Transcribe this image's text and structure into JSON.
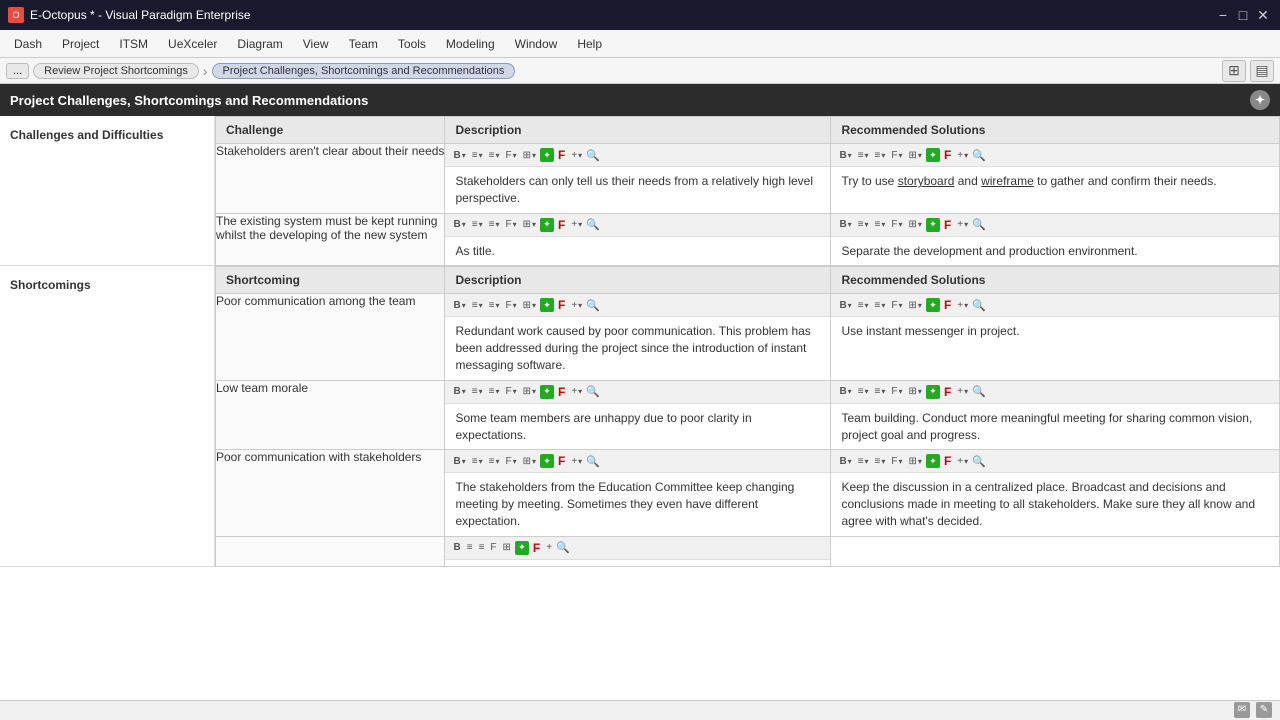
{
  "titlebar": {
    "title": "E-Octopus * - Visual Paradigm Enterprise",
    "icon": "O",
    "min": "−",
    "max": "□",
    "close": "✕"
  },
  "menu": {
    "items": [
      "Dash",
      "Project",
      "ITSM",
      "UeXceler",
      "Diagram",
      "View",
      "Team",
      "Tools",
      "Modeling",
      "Window",
      "Help"
    ]
  },
  "breadcrumb": {
    "more": "...",
    "items": [
      "Review Project Shortcomings",
      "Project Challenges, Shortcomings and Recommendations"
    ]
  },
  "pageHeader": {
    "title": "Project Challenges, Shortcomings and Recommendations"
  },
  "sections": [
    {
      "label": "Challenges and Difficulties",
      "columns": [
        "Challenge",
        "Description",
        "Recommended Solutions"
      ],
      "rows": [
        {
          "challenge": "Stakeholders aren't clear about their needs",
          "description": "Stakeholders can only tell us their needs from a relatively high level perspective.",
          "recommended": "Try to use storyboard and wireframe to gather and confirm their needs."
        },
        {
          "challenge": "The existing system must be kept running whilst the developing of the new system",
          "description": "As title.",
          "recommended": "Separate the development and production environment."
        }
      ]
    },
    {
      "label": "Shortcomings",
      "columns": [
        "Shortcoming",
        "Description",
        "Recommended Solutions"
      ],
      "rows": [
        {
          "challenge": "Poor communication among the team",
          "description": "Redundant work caused by poor communication. This problem has been addressed during the project since the introduction of instant messaging software.",
          "recommended": "Use instant messenger in project."
        },
        {
          "challenge": "Low team morale",
          "description": "Some team members are unhappy due to poor clarity in expectations.",
          "recommended": "Team building. Conduct more meaningful meeting for sharing common vision, project goal and progress."
        },
        {
          "challenge": "Poor communication with stakeholders",
          "description": "The stakeholders from the Education Committee keep changing meeting by meeting. Sometimes they even have different expectation.",
          "recommended": "Keep the discussion in a centralized place. Broadcast and decisions and conclusions made in meeting to all stakeholders. Make sure they all know and agree with what's decided."
        }
      ]
    }
  ],
  "toolbar": {
    "bold": "B",
    "boldCaret": "▾",
    "alignCaret": "▾",
    "spaceCaret": "▾",
    "fontCaret": "F▾",
    "tableCaret": "▾",
    "plusCaret": "+▾"
  }
}
